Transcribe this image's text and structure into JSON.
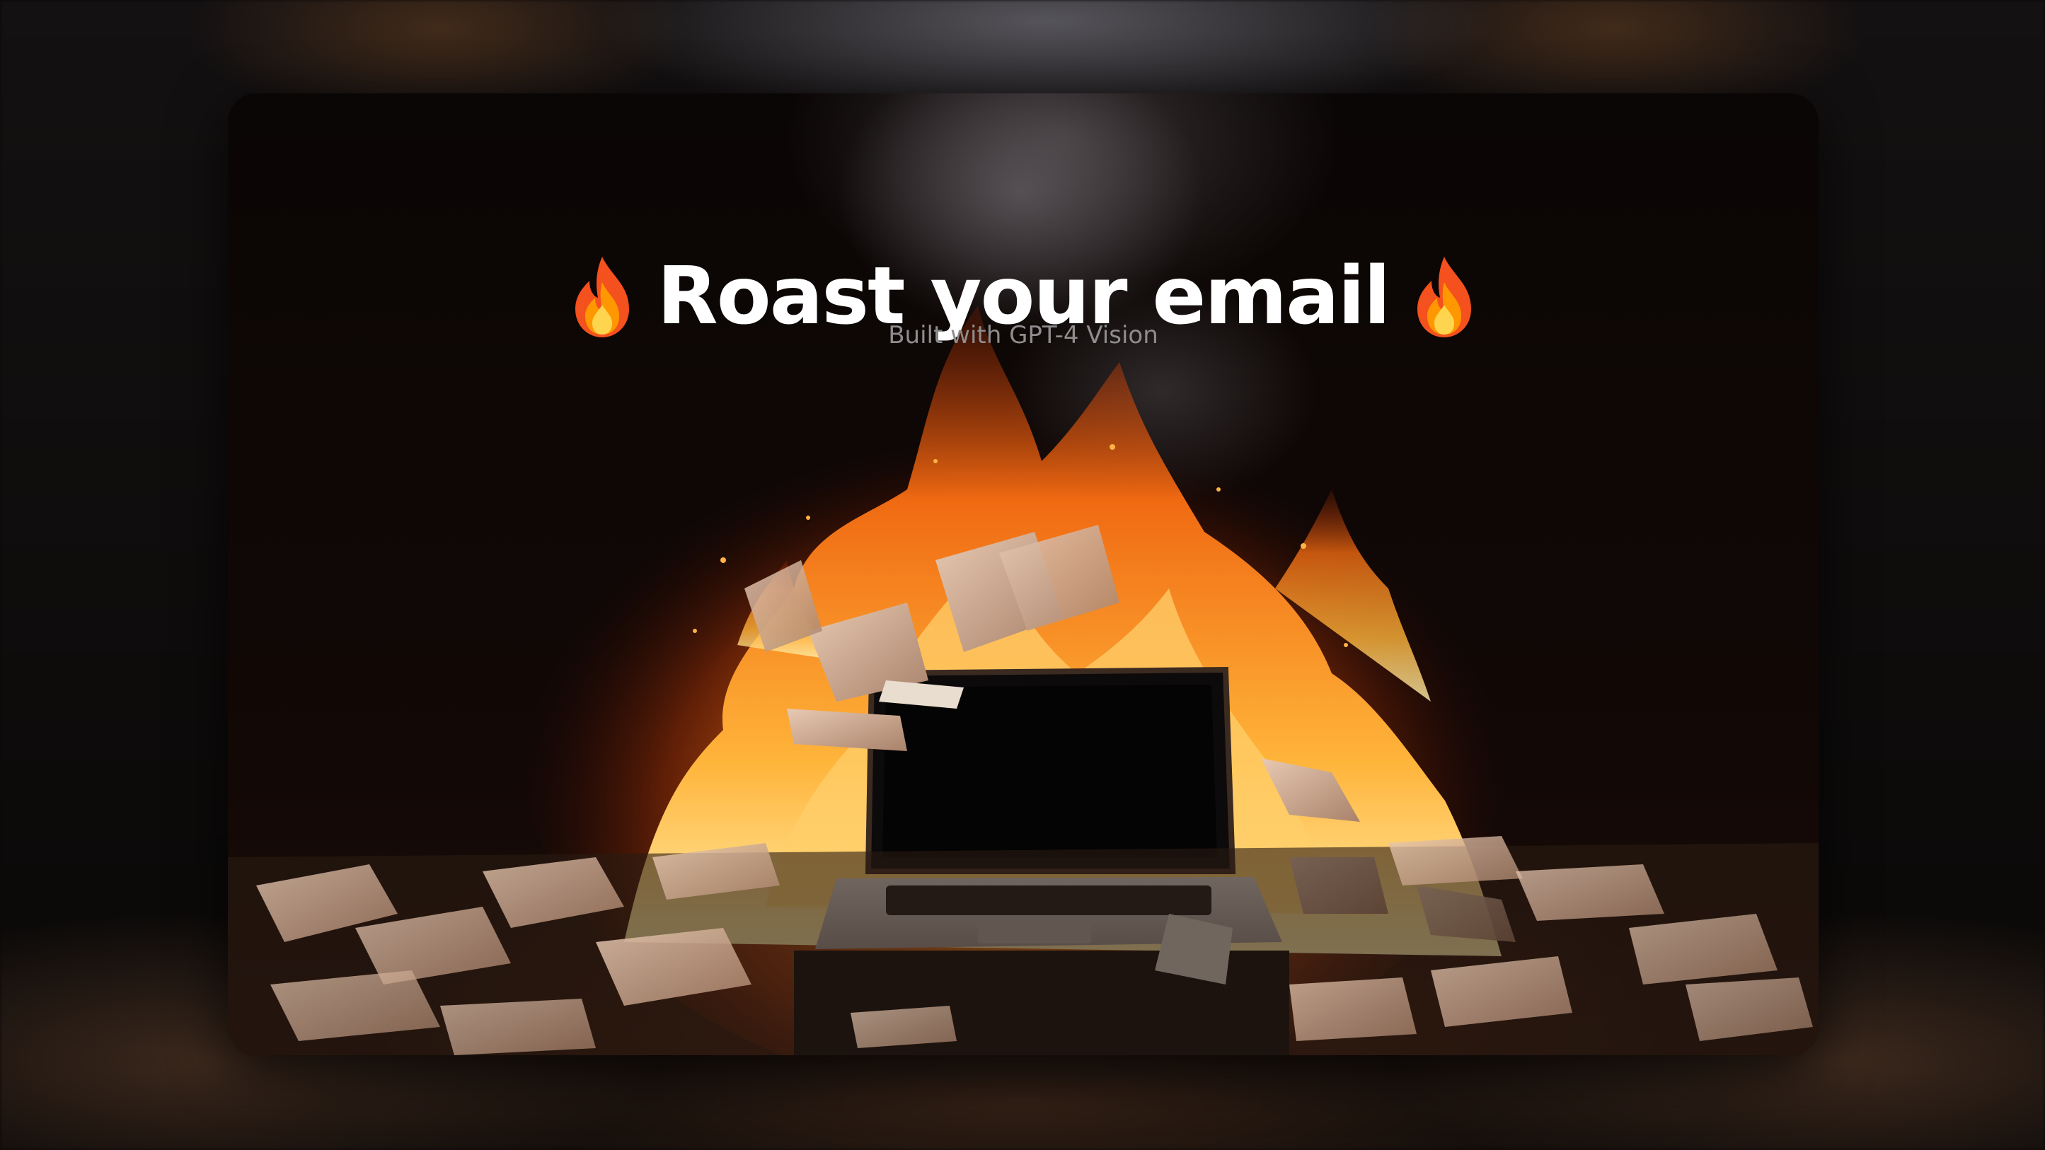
{
  "header": {
    "title": "Roast your email",
    "subtitle": "Built with GPT-4 Vision",
    "title_icon_left": "fire-icon",
    "title_icon_right": "fire-icon"
  },
  "hero": {
    "image_subject": "laptop-engulfed-in-flames-with-burning-papers",
    "accent_color": "#ff7a1a"
  }
}
